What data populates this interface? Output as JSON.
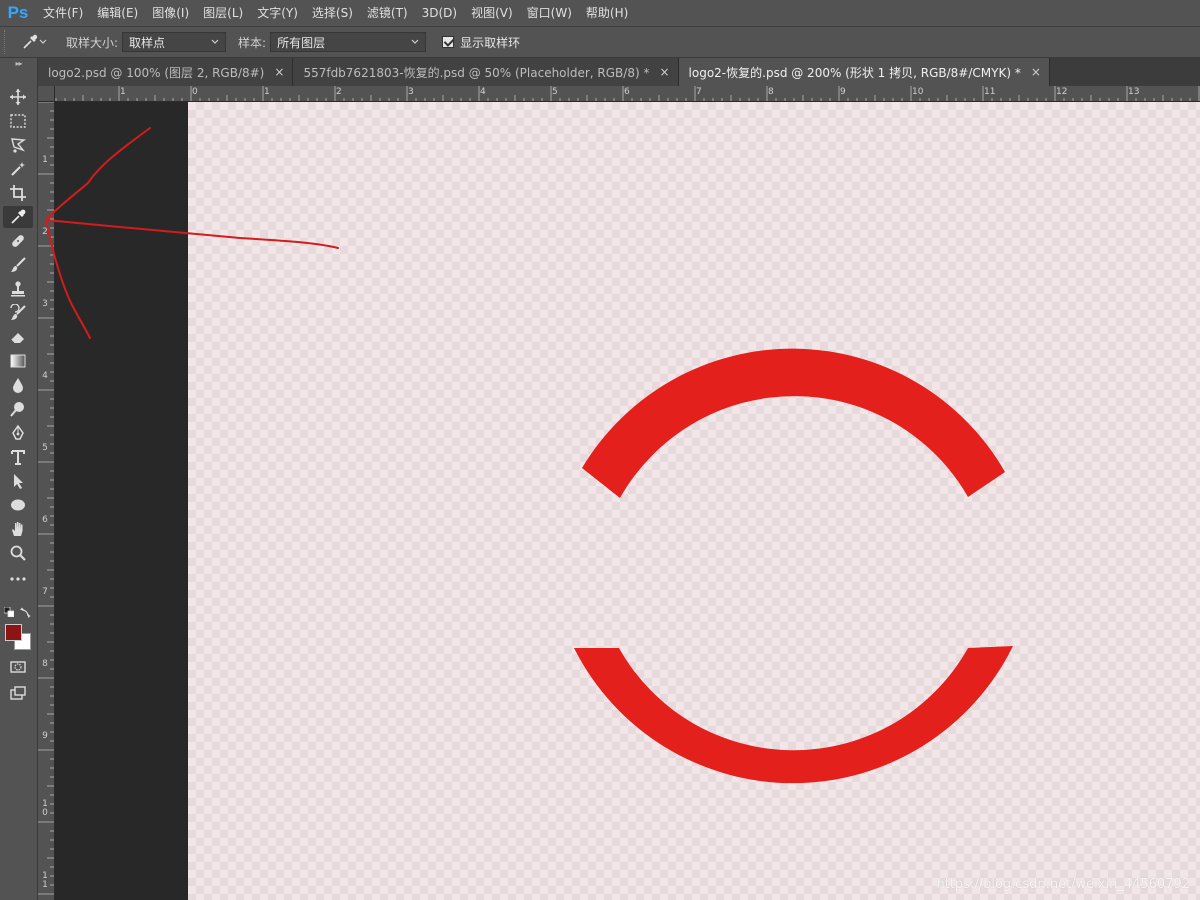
{
  "app": {
    "logo": "Ps"
  },
  "menu": [
    "文件(F)",
    "编辑(E)",
    "图像(I)",
    "图层(L)",
    "文字(Y)",
    "选择(S)",
    "滤镜(T)",
    "3D(D)",
    "视图(V)",
    "窗口(W)",
    "帮助(H)"
  ],
  "options": {
    "sample_size_label": "取样大小:",
    "sample_size_value": "取样点",
    "sample_label": "样本:",
    "sample_value": "所有图层",
    "show_ring_label": "显示取样环"
  },
  "tabs": [
    {
      "label": "logo2.psd @ 100% (图层 2, RGB/8#)",
      "close": "×"
    },
    {
      "label": "557fdb7621803-恢复的.psd @ 50% (Placeholder, RGB/8) *",
      "close": "×"
    },
    {
      "label": "logo2-恢复的.psd @ 200% (形状 1 拷贝, RGB/8#/CMYK) *",
      "close": "×"
    }
  ],
  "ruler_h": [
    "1",
    "0",
    "1",
    "2",
    "3",
    "4",
    "5",
    "6",
    "7",
    "8",
    "9",
    "10",
    "11",
    "12",
    "13"
  ],
  "ruler_v": [
    "1",
    "2",
    "3",
    "4",
    "5",
    "6",
    "7",
    "8",
    "9",
    "10",
    "11"
  ],
  "tools": [
    "move-icon",
    "marquee-icon",
    "lasso-icon",
    "magic-wand-icon",
    "crop-icon",
    "eyedropper-icon",
    "healing-brush-icon",
    "brush-icon",
    "stamp-icon",
    "history-brush-icon",
    "eraser-icon",
    "gradient-icon",
    "blur-icon",
    "dodge-icon",
    "pen-icon",
    "type-icon",
    "path-select-icon",
    "ellipse-icon",
    "hand-icon",
    "zoom-icon",
    "more-icon"
  ],
  "colors": {
    "foreground": "#8b1414",
    "background": "#ffffff",
    "shape": "#e3201b",
    "annotation": "#d41c1c",
    "accent": "#31a8ff"
  },
  "watermark": "https://blog.csdn.net/weixin_44560792"
}
